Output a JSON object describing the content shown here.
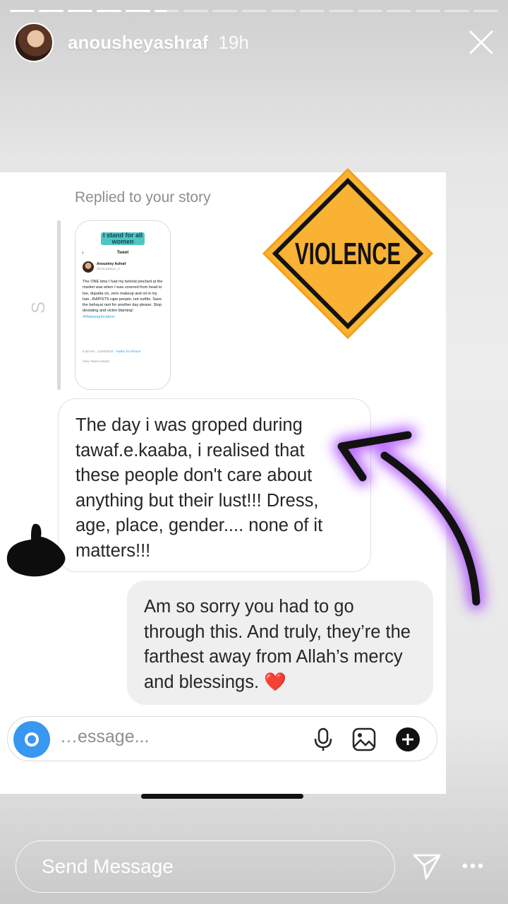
{
  "story": {
    "username": "anousheyashraf",
    "time": "19h",
    "progress": {
      "segments_total": 17,
      "segments_done": 5,
      "current_segment_fill": 0.5
    }
  },
  "dm": {
    "replied_label": "Replied to your story",
    "side_letter": "S",
    "thumbnail": {
      "logo_text": "I stand for all women",
      "header": "Tweet",
      "author": "Anoushey Ashraf",
      "handle": "@AnousheyA_A",
      "body": "The ONE time I had my behind pinched at the market was when I was covered from head to toe, dupatta on, zero makeup and oil in my hair...RAPISTS rape people, not outfits. Save the behayai rant for another day please. Stop deviating and victim blaming!",
      "hashtag": "#MotowayIncident",
      "meta_time": "5:48 PM · 12/09/2020 ·",
      "meta_client": "Twitter for iPhone",
      "activity": "View Tweet activity"
    },
    "incoming_message": "The day i was groped during tawaf.e.kaaba, i realised that these people don't care about anything but their lust!!!  Dress, age, place, gender.... none of it matters!!!",
    "outgoing_message": "Am so sorry you had to go through this. And truly, they’re the farthest away from Allah’s mercy and blessings. ❤️",
    "composer_placeholder": "…essage..."
  },
  "sticker": {
    "text": "VIOLENCE",
    "color": "#f9b233"
  },
  "footer": {
    "send_placeholder": "Send Message"
  },
  "colors": {
    "accent_blue": "#3897f0",
    "arrow_glow": "#a335ff"
  }
}
